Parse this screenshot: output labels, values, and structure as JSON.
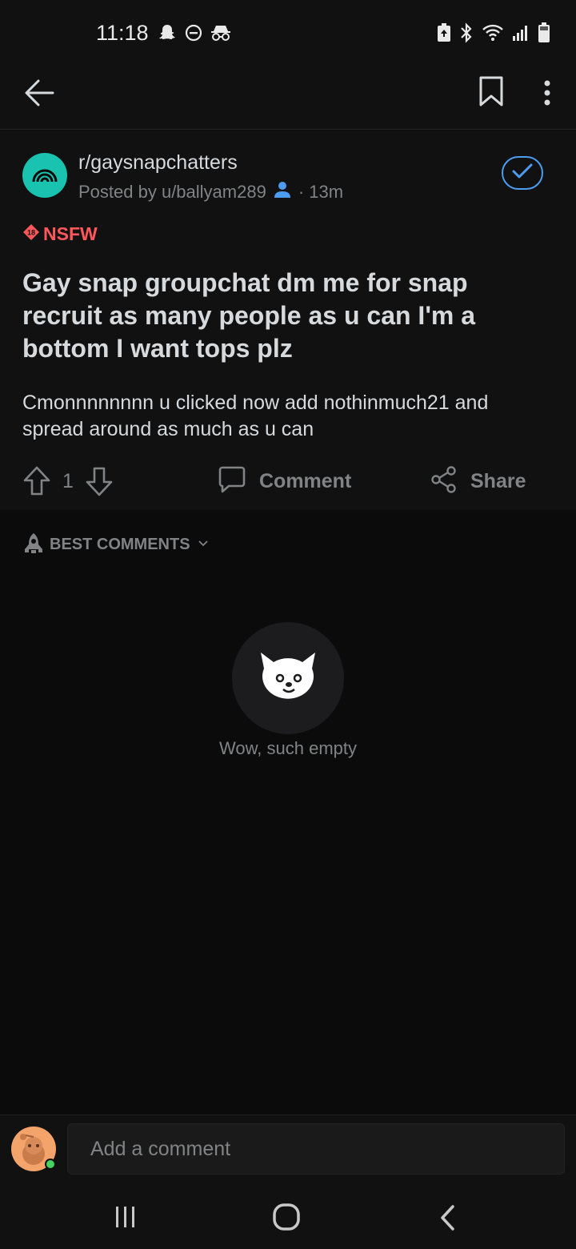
{
  "status_bar": {
    "time": "11:18",
    "left_icons": [
      "snapchat-icon",
      "do-not-disturb-icon",
      "incognito-icon"
    ],
    "right_icons": [
      "battery-saver-icon",
      "bluetooth-icon",
      "wifi-icon",
      "signal-icon",
      "battery-icon"
    ]
  },
  "header": {
    "icons": [
      "back-arrow-icon",
      "bookmark-icon",
      "more-vertical-icon"
    ]
  },
  "post": {
    "subreddit": "r/gaysnapchatters",
    "posted_by": "Posted by u/ballyam289",
    "time_ago": "· 13m",
    "joined_icon": "checkmark-icon",
    "nsfw_label": "NSFW",
    "title": "Gay snap groupchat dm me for snap recruit as many people as u can I'm a bottom I want tops plz",
    "body": "Cmonnnnnnnn u clicked now add nothinmuch21 and spread around as much as u can",
    "score": "1",
    "comment_label": "Comment",
    "share_label": "Share"
  },
  "comments": {
    "sort_label": "BEST COMMENTS",
    "empty_text": "Wow, such empty"
  },
  "comment_bar": {
    "placeholder": "Add a comment"
  },
  "colors": {
    "background": "#0b0b0c",
    "card": "#111112",
    "accent_blue": "#4c9cf2",
    "nsfw_red": "#ff585b",
    "subreddit_teal": "#19c3b0",
    "muted_text": "#818384"
  }
}
